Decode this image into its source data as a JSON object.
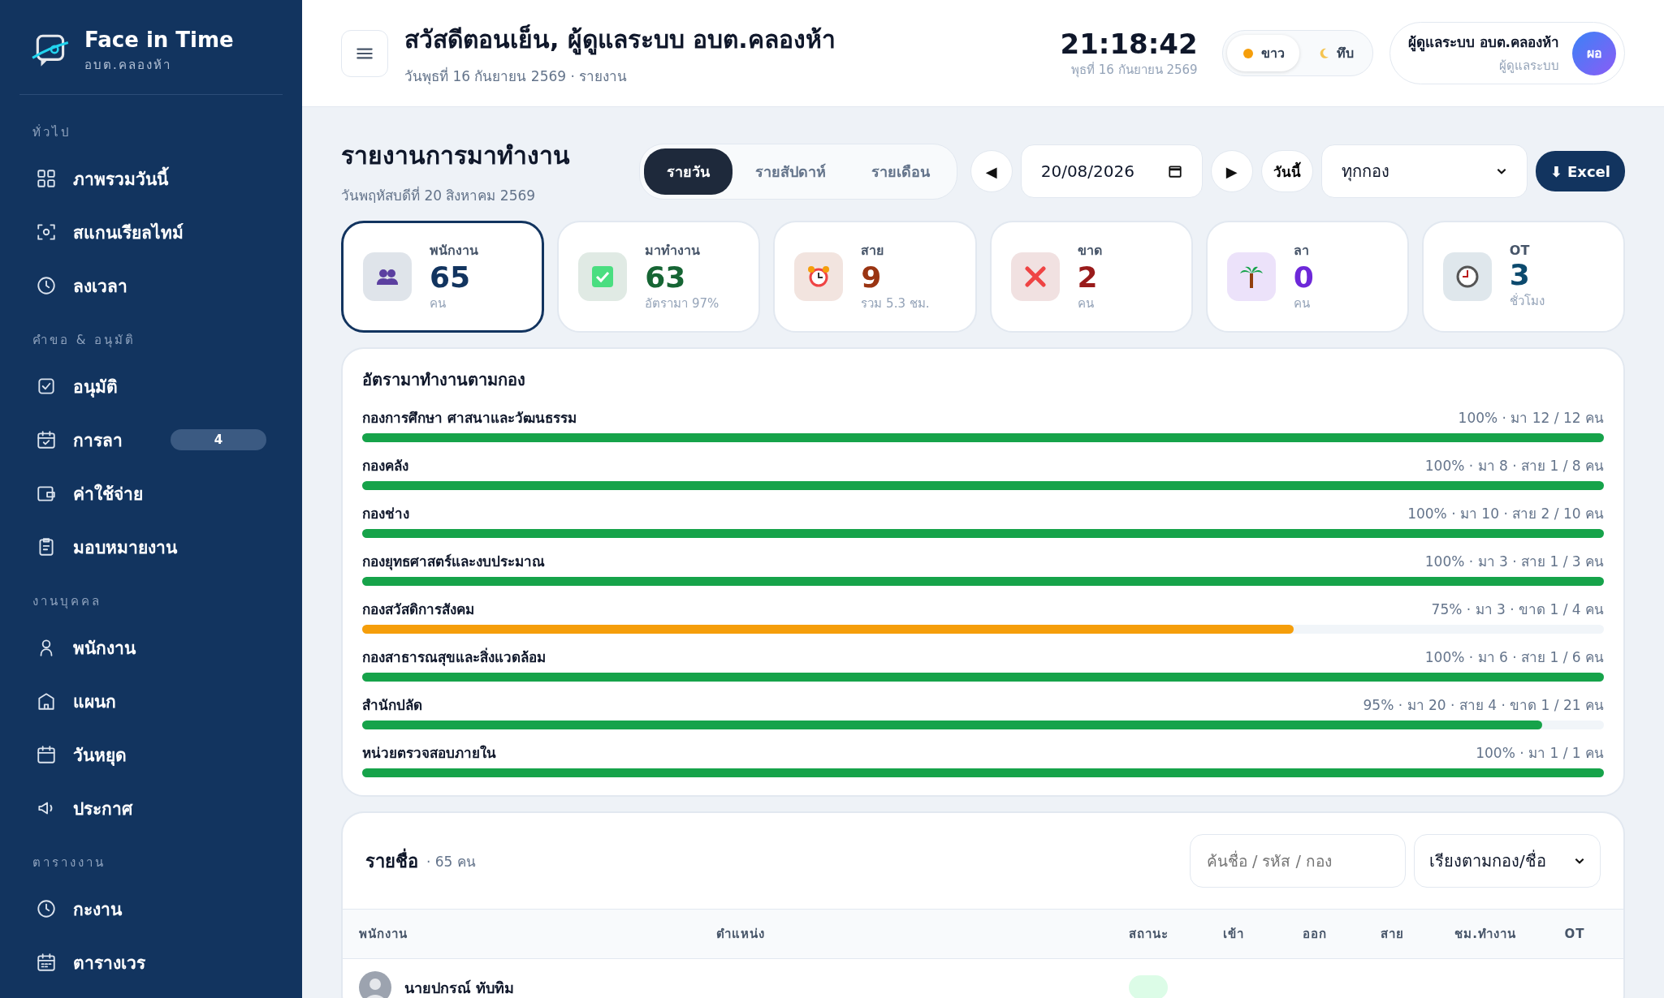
{
  "sidebar": {
    "brand": "Face in Time",
    "org": "อบต.คลองห้า",
    "sections": [
      {
        "title": "ทั่วไป",
        "items": [
          {
            "label": "ภาพรวมวันนี้"
          },
          {
            "label": "สแกนเรียลไทม์"
          },
          {
            "label": "ลงเวลา"
          }
        ]
      },
      {
        "title": "คำขอ & อนุมัติ",
        "items": [
          {
            "label": "อนุมัติ"
          },
          {
            "label": "การลา",
            "badge": "4"
          },
          {
            "label": "ค่าใช้จ่าย"
          },
          {
            "label": "มอบหมายงาน"
          }
        ]
      },
      {
        "title": "งานบุคคล",
        "items": [
          {
            "label": "พนักงาน"
          },
          {
            "label": "แผนก"
          },
          {
            "label": "วันหยุด"
          },
          {
            "label": "ประกาศ"
          }
        ]
      },
      {
        "title": "ตารางงาน",
        "items": [
          {
            "label": "กะงาน"
          },
          {
            "label": "ตารางเวร"
          }
        ]
      }
    ]
  },
  "header": {
    "greeting": "สวัสดีตอนเย็น, ผู้ดูแลระบบ อบต.คลองห้า",
    "subtitle": "วันพุธที่ 16 กันยายน 2569 · รายงาน",
    "time": "21:18:42",
    "date": "พุธที่ 16 กันยายน 2569",
    "theme": [
      {
        "label": "ขาว",
        "selected": true
      },
      {
        "label": "ทึบ",
        "selected": false
      }
    ],
    "user": {
      "name": "ผู้ดูแลระบบ อบต.คลองห้า",
      "role": "ผู้ดูแลระบบ",
      "initials": "ผอ"
    }
  },
  "report": {
    "title": "รายงานการมาทำงาน",
    "date": "วันพฤหัสบดีที่ 20 สิงหาคม 2569",
    "periods": [
      {
        "label": "รายวัน",
        "selected": true
      },
      {
        "label": "รายสัปดาห์",
        "selected": false
      },
      {
        "label": "รายเดือน",
        "selected": false
      }
    ],
    "prev": "◀",
    "date_value": "20/08/2026",
    "next": "▶",
    "today": "วันนี้",
    "division_filter": "ทุกกอง",
    "export": "⬇ Excel"
  },
  "cards": [
    {
      "label": "พนักงาน",
      "value": "65",
      "sub": "คน",
      "color": "#12345f",
      "selected": true
    },
    {
      "label": "มาทำงาน",
      "value": "63",
      "sub": "อัตรามา 97%",
      "color": "#166534",
      "selected": false
    },
    {
      "label": "สาย",
      "value": "9",
      "sub": "รวม 5.3 ชม.",
      "color": "#9a3412",
      "selected": false
    },
    {
      "label": "ขาด",
      "value": "2",
      "sub": "คน",
      "color": "#991b1b",
      "selected": false
    },
    {
      "label": "ลา",
      "value": "0",
      "sub": "คน",
      "color": "#6d28d9",
      "selected": false
    },
    {
      "label": "OT",
      "value": "3",
      "sub": "ชั่วโมง",
      "color": "#0c4a6e",
      "selected": false
    }
  ],
  "divisions": {
    "title": "อัตรามาทำงานตามกอง",
    "rows": [
      {
        "name": "กองการศึกษา ศาสนาและวัฒนธรรม",
        "stats": "100% · มา 12 / 12 คน",
        "level": 1,
        "color": "#16a34a"
      },
      {
        "name": "กองคลัง",
        "stats": "100% · มา 8 · สาย 1 / 8 คน",
        "level": 1,
        "color": "#16a34a"
      },
      {
        "name": "กองช่าง",
        "stats": "100% · มา 10 · สาย 2 / 10 คน",
        "level": 1,
        "color": "#16a34a"
      },
      {
        "name": "กองยุทธศาสตร์และงบประมาณ",
        "stats": "100% · มา 3 · สาย 1 / 3 คน",
        "level": 1,
        "color": "#16a34a"
      },
      {
        "name": "กองสวัสดิการสังคม",
        "stats": "75% · มา 3 · ขาด 1 / 4 คน",
        "level": 0.75,
        "color": "#f59e0b"
      },
      {
        "name": "กองสาธารณสุขและสิ่งแวดล้อม",
        "stats": "100% · มา 6 · สาย 1 / 6 คน",
        "level": 1,
        "color": "#16a34a"
      },
      {
        "name": "สำนักปลัด",
        "stats": "95% · มา 20 · สาย 4 · ขาด 1 / 21 คน",
        "level": 0.95,
        "color": "#16a34a"
      },
      {
        "name": "หน่วยตรวจสอบภายใน",
        "stats": "100% · มา 1 / 1 คน",
        "level": 1,
        "color": "#16a34a"
      }
    ]
  },
  "roster": {
    "title": "รายชื่อ",
    "count": "· 65 คน",
    "search": {
      "placeholder": "ค้นชื่อ / รหัส / กอง"
    },
    "sort": "เรียงตามกอง/ชื่อ",
    "columns": [
      "พนักงาน",
      "ตำแหน่ง",
      "สถานะ",
      "เข้า",
      "ออก",
      "สาย",
      "ชม.ทำงาน",
      "OT"
    ],
    "rows": [
      {
        "name": "นายปกรณ์ ทับทิม"
      }
    ]
  }
}
